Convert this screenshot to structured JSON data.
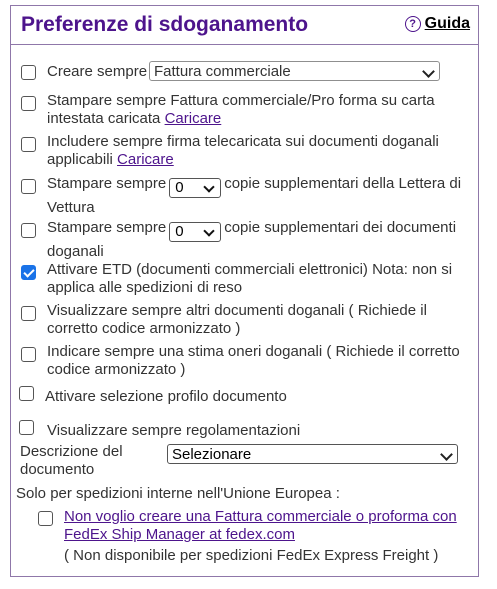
{
  "header": {
    "title": "Preferenze di sdoganamento",
    "help_label": "Guida"
  },
  "options": {
    "create_always": {
      "label": "Creare sempre",
      "checked": false,
      "select_value": "Fattura commerciale"
    },
    "print_invoice": {
      "text": "Stampare sempre Fattura commerciale/Pro forma su carta intestata caricata",
      "link": "Caricare",
      "checked": false
    },
    "include_signature": {
      "text": "Includere sempre firma telecaricata sui documenti doganali applicabili",
      "link": "Caricare",
      "checked": false
    },
    "print_awb_copies": {
      "prefix": "Stampare sempre",
      "value": "0",
      "suffix": "copie supplementari della Lettera di Vettura",
      "checked": false
    },
    "print_doc_copies": {
      "prefix": "Stampare sempre",
      "value": "0",
      "suffix": "copie supplementari dei documenti doganali",
      "checked": false
    },
    "etd": {
      "text": "Attivare ETD (documenti commerciali elettronici) Nota: non si applica alle spedizioni di reso",
      "checked": true
    },
    "show_other_docs": {
      "text": "Visualizzare sempre altri documenti doganali ( Richiede il corretto codice armonizzato )",
      "checked": false
    },
    "estimate_duties": {
      "text": "Indicare sempre una stima oneri doganali ( Richiede il corretto codice armonizzato )",
      "checked": false
    },
    "doc_profile": {
      "text": "Attivare selezione profilo documento",
      "checked": false
    },
    "show_regulations": {
      "text": "Visualizzare sempre regolamentazioni",
      "checked": false
    }
  },
  "doc_description": {
    "label": "Descrizione del documento",
    "select_value": "Selezionare"
  },
  "eu": {
    "heading": "Solo per spedizioni interne nell'Unione Europea :",
    "link_text": "Non voglio creare una Fattura commerciale o proforma con FedEx Ship Manager at fedex.com",
    "checked": false,
    "note": "( Non disponibile per spedizioni FedEx Express Freight )"
  }
}
